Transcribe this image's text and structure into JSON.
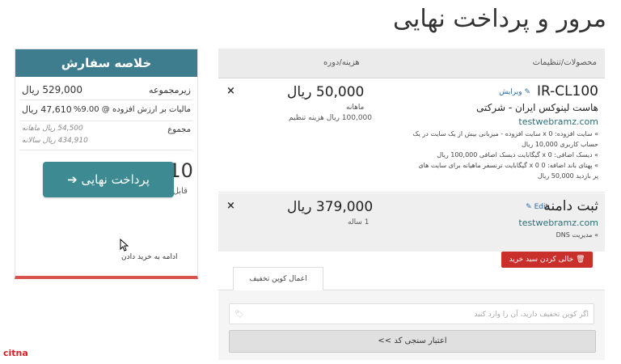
{
  "page": {
    "title": "مرور و پرداخت نهایی"
  },
  "summary": {
    "header": "خلاصه سفارش",
    "subtotal_label": "زیرمجموعه",
    "subtotal_value": "529,000 ریال",
    "vat_label": "مالیات بر ارزش افزوده @ 9.00%",
    "vat_value": "47,610 ریال",
    "totals_label": "مجموع",
    "monthly": "54,500 ریال ماهانه",
    "yearly": "434,910 ریال سالانه",
    "total_amount": "576,610 ریال",
    "total_caption": "قابل پرداخت",
    "checkout_label": "پرداخت نهایی ➔",
    "continue_note": "ادامه به خرید دادن"
  },
  "cart": {
    "col_products": "محصولات/تنظیمات",
    "col_price": "هزینه/دوره",
    "items": [
      {
        "name": "IR-CL100",
        "edit_label": "ویرایش",
        "subtitle": "هاست لینوکس ایران - شرکتی",
        "domain": "testwebramz.com",
        "features": [
          "» سایت افزوده: 0 x سایت افزوده - میزبانی بیش از یک سایت در یک",
          "حساب کاربری 10,000 ریال",
          "» دیسک اضافی: 0 x گیگابایت دیسک اضافی 100,000 ریال",
          "» پهنای باند اضافه: 0 x 0 گیگابایت ترنسفر ماهیانه برای سایت های",
          "پر بازدید 50,000 ریال"
        ],
        "price": "50,000 ریال",
        "cycle": "ماهانه",
        "setup": "100,000 ریال هزینه تنظیم",
        "remove": "×"
      },
      {
        "name": "ثبت دامنه",
        "edit_label": "Edit",
        "domain": "testwebramz.com",
        "dns_label": "» مدیریت DNS",
        "price": "379,000 ریال",
        "cycle": "1 ساله",
        "remove": "×"
      }
    ],
    "empty_cart_label": "خالی کردن سبد خرید"
  },
  "promo": {
    "tab_label": "اعمال کوپن تخفیف",
    "input_placeholder": "اگر کوپن تخفیف دارید، آن را وارد کنید",
    "validate_label": "اعتبار سنجی کد >>"
  },
  "watermark": "citna",
  "colors": {
    "accent": "#3e7d8d",
    "danger": "#c9302c",
    "link": "#2a6aa3"
  }
}
